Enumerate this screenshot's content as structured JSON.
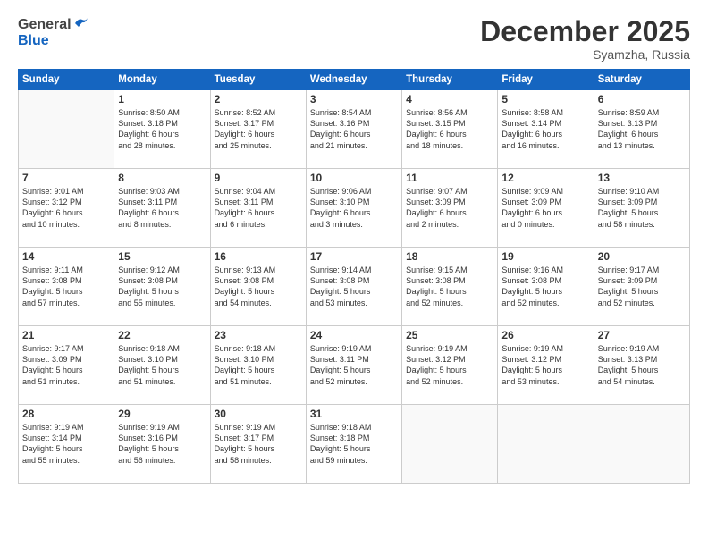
{
  "header": {
    "logo_general": "General",
    "logo_blue": "Blue",
    "title": "December 2025",
    "location": "Syamzha, Russia"
  },
  "days_header": [
    "Sunday",
    "Monday",
    "Tuesday",
    "Wednesday",
    "Thursday",
    "Friday",
    "Saturday"
  ],
  "weeks": [
    [
      {
        "day": "",
        "content": ""
      },
      {
        "day": "1",
        "content": "Sunrise: 8:50 AM\nSunset: 3:18 PM\nDaylight: 6 hours\nand 28 minutes."
      },
      {
        "day": "2",
        "content": "Sunrise: 8:52 AM\nSunset: 3:17 PM\nDaylight: 6 hours\nand 25 minutes."
      },
      {
        "day": "3",
        "content": "Sunrise: 8:54 AM\nSunset: 3:16 PM\nDaylight: 6 hours\nand 21 minutes."
      },
      {
        "day": "4",
        "content": "Sunrise: 8:56 AM\nSunset: 3:15 PM\nDaylight: 6 hours\nand 18 minutes."
      },
      {
        "day": "5",
        "content": "Sunrise: 8:58 AM\nSunset: 3:14 PM\nDaylight: 6 hours\nand 16 minutes."
      },
      {
        "day": "6",
        "content": "Sunrise: 8:59 AM\nSunset: 3:13 PM\nDaylight: 6 hours\nand 13 minutes."
      }
    ],
    [
      {
        "day": "7",
        "content": "Sunrise: 9:01 AM\nSunset: 3:12 PM\nDaylight: 6 hours\nand 10 minutes."
      },
      {
        "day": "8",
        "content": "Sunrise: 9:03 AM\nSunset: 3:11 PM\nDaylight: 6 hours\nand 8 minutes."
      },
      {
        "day": "9",
        "content": "Sunrise: 9:04 AM\nSunset: 3:11 PM\nDaylight: 6 hours\nand 6 minutes."
      },
      {
        "day": "10",
        "content": "Sunrise: 9:06 AM\nSunset: 3:10 PM\nDaylight: 6 hours\nand 3 minutes."
      },
      {
        "day": "11",
        "content": "Sunrise: 9:07 AM\nSunset: 3:09 PM\nDaylight: 6 hours\nand 2 minutes."
      },
      {
        "day": "12",
        "content": "Sunrise: 9:09 AM\nSunset: 3:09 PM\nDaylight: 6 hours\nand 0 minutes."
      },
      {
        "day": "13",
        "content": "Sunrise: 9:10 AM\nSunset: 3:09 PM\nDaylight: 5 hours\nand 58 minutes."
      }
    ],
    [
      {
        "day": "14",
        "content": "Sunrise: 9:11 AM\nSunset: 3:08 PM\nDaylight: 5 hours\nand 57 minutes."
      },
      {
        "day": "15",
        "content": "Sunrise: 9:12 AM\nSunset: 3:08 PM\nDaylight: 5 hours\nand 55 minutes."
      },
      {
        "day": "16",
        "content": "Sunrise: 9:13 AM\nSunset: 3:08 PM\nDaylight: 5 hours\nand 54 minutes."
      },
      {
        "day": "17",
        "content": "Sunrise: 9:14 AM\nSunset: 3:08 PM\nDaylight: 5 hours\nand 53 minutes."
      },
      {
        "day": "18",
        "content": "Sunrise: 9:15 AM\nSunset: 3:08 PM\nDaylight: 5 hours\nand 52 minutes."
      },
      {
        "day": "19",
        "content": "Sunrise: 9:16 AM\nSunset: 3:08 PM\nDaylight: 5 hours\nand 52 minutes."
      },
      {
        "day": "20",
        "content": "Sunrise: 9:17 AM\nSunset: 3:09 PM\nDaylight: 5 hours\nand 52 minutes."
      }
    ],
    [
      {
        "day": "21",
        "content": "Sunrise: 9:17 AM\nSunset: 3:09 PM\nDaylight: 5 hours\nand 51 minutes."
      },
      {
        "day": "22",
        "content": "Sunrise: 9:18 AM\nSunset: 3:10 PM\nDaylight: 5 hours\nand 51 minutes."
      },
      {
        "day": "23",
        "content": "Sunrise: 9:18 AM\nSunset: 3:10 PM\nDaylight: 5 hours\nand 51 minutes."
      },
      {
        "day": "24",
        "content": "Sunrise: 9:19 AM\nSunset: 3:11 PM\nDaylight: 5 hours\nand 52 minutes."
      },
      {
        "day": "25",
        "content": "Sunrise: 9:19 AM\nSunset: 3:12 PM\nDaylight: 5 hours\nand 52 minutes."
      },
      {
        "day": "26",
        "content": "Sunrise: 9:19 AM\nSunset: 3:12 PM\nDaylight: 5 hours\nand 53 minutes."
      },
      {
        "day": "27",
        "content": "Sunrise: 9:19 AM\nSunset: 3:13 PM\nDaylight: 5 hours\nand 54 minutes."
      }
    ],
    [
      {
        "day": "28",
        "content": "Sunrise: 9:19 AM\nSunset: 3:14 PM\nDaylight: 5 hours\nand 55 minutes."
      },
      {
        "day": "29",
        "content": "Sunrise: 9:19 AM\nSunset: 3:16 PM\nDaylight: 5 hours\nand 56 minutes."
      },
      {
        "day": "30",
        "content": "Sunrise: 9:19 AM\nSunset: 3:17 PM\nDaylight: 5 hours\nand 58 minutes."
      },
      {
        "day": "31",
        "content": "Sunrise: 9:18 AM\nSunset: 3:18 PM\nDaylight: 5 hours\nand 59 minutes."
      },
      {
        "day": "",
        "content": ""
      },
      {
        "day": "",
        "content": ""
      },
      {
        "day": "",
        "content": ""
      }
    ]
  ]
}
